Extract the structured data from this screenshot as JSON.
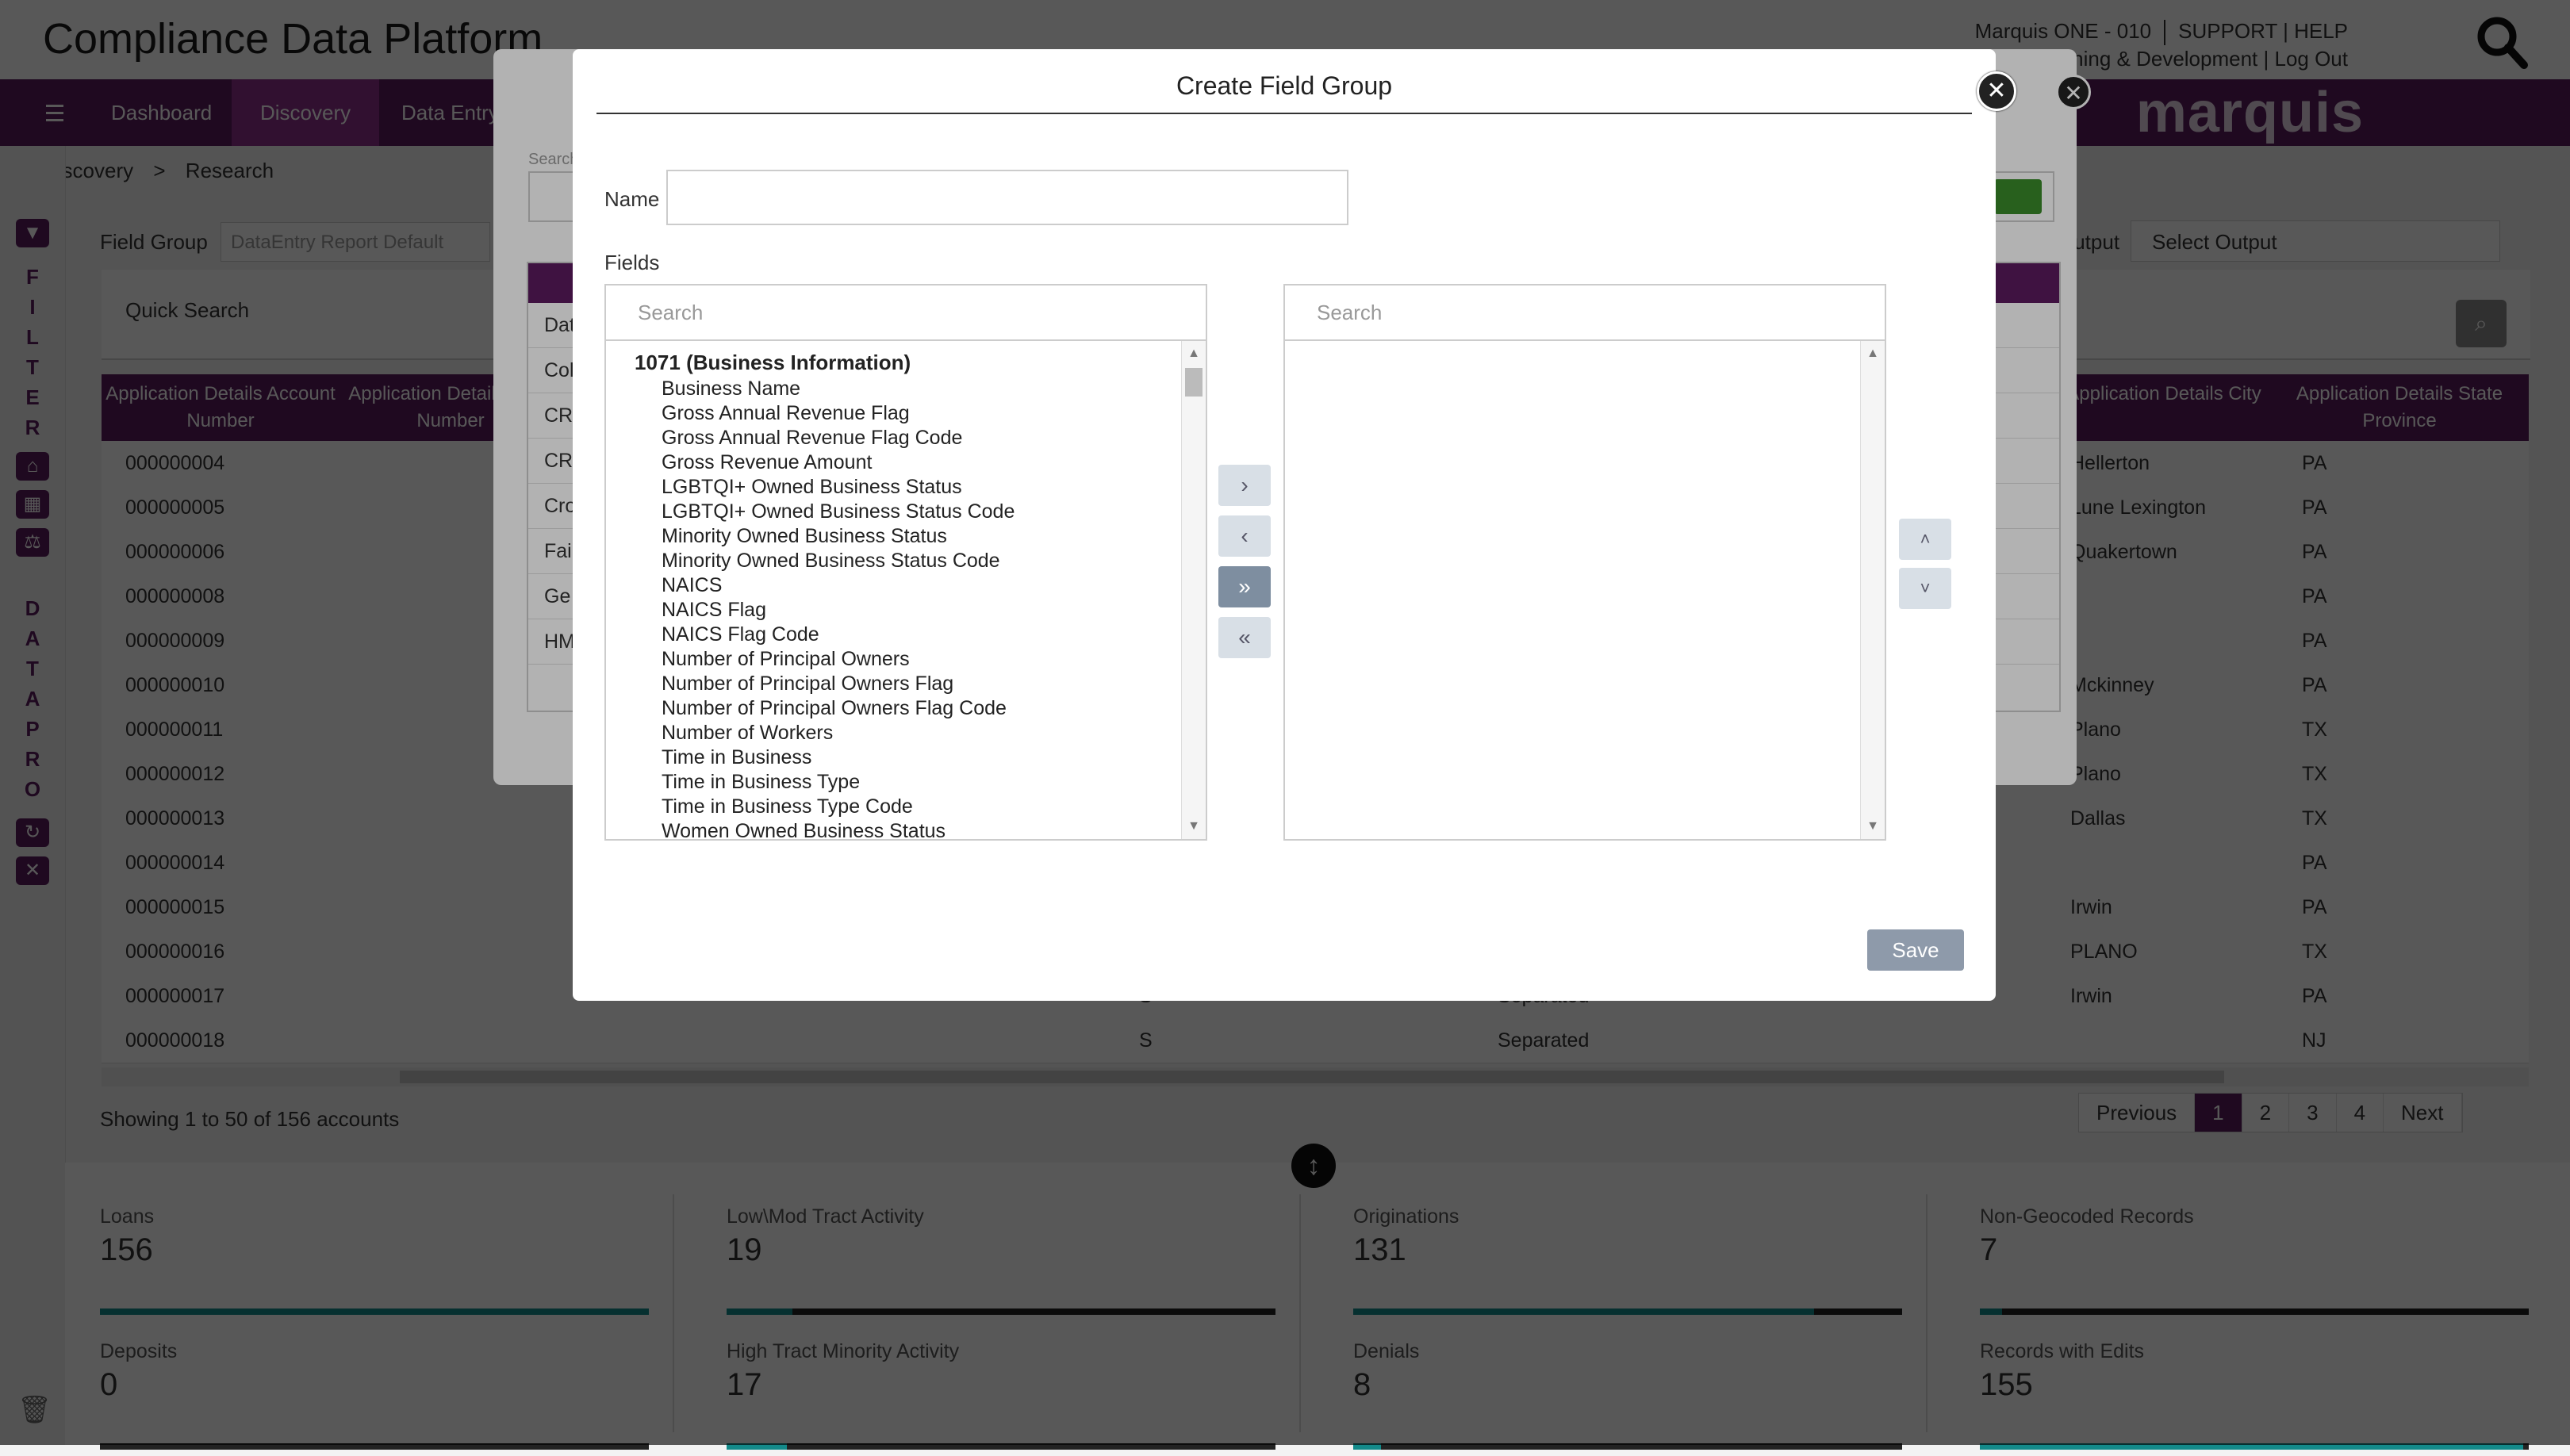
{
  "app": {
    "title": "Compliance Data Platform",
    "account_line1": "Marquis ONE - 010",
    "support": "SUPPORT | HELP",
    "account_line2": "Marquis Learning & Development | Log Out",
    "brand": "marquis"
  },
  "nav": {
    "items": [
      "Dashboard",
      "Discovery",
      "Data Entry"
    ],
    "active": "Discovery"
  },
  "breadcrumb": {
    "root": "Discovery",
    "sep": ">",
    "current": "Research"
  },
  "rail": {
    "filter_letters": [
      "F",
      "I",
      "L",
      "T",
      "E",
      "R"
    ],
    "datapro_letters": [
      "D",
      "A",
      "T",
      "A",
      "P",
      "R",
      "O"
    ]
  },
  "main": {
    "field_group_label": "Field Group",
    "field_group_value": "DataEntry Report Default",
    "output_label": "Output",
    "output_value": "Select Output",
    "quick_search": "Quick Search",
    "columns": [
      "Application Details Account Number",
      "Application Details Loan Number",
      "Application Details City",
      "Application Details State Province"
    ],
    "rows": [
      {
        "acct": "000000004",
        "mid1": "",
        "mid2": "",
        "city": "Hellerton",
        "state": "PA"
      },
      {
        "acct": "000000005",
        "mid1": "",
        "mid2": "",
        "city": "Lune Lexington",
        "state": "PA"
      },
      {
        "acct": "000000006",
        "mid1": "",
        "mid2": "",
        "city": "Quakertown",
        "state": "PA"
      },
      {
        "acct": "000000008",
        "mid1": "",
        "mid2": "",
        "city": "",
        "state": "PA"
      },
      {
        "acct": "000000009",
        "mid1": "",
        "mid2": "",
        "city": "",
        "state": "PA"
      },
      {
        "acct": "000000010",
        "mid1": "",
        "mid2": "",
        "city": "Mckinney",
        "state": "PA"
      },
      {
        "acct": "000000011",
        "mid1": "",
        "mid2": "",
        "city": "Plano",
        "state": "TX"
      },
      {
        "acct": "000000012",
        "mid1": "",
        "mid2": "",
        "city": "Plano",
        "state": "TX"
      },
      {
        "acct": "000000013",
        "mid1": "",
        "mid2": "",
        "city": "Dallas",
        "state": "TX"
      },
      {
        "acct": "000000014",
        "mid1": "",
        "mid2": "",
        "city": "",
        "state": "PA"
      },
      {
        "acct": "000000015",
        "mid1": "",
        "mid2": "",
        "city": "Irwin",
        "state": "PA"
      },
      {
        "acct": "000000016",
        "mid1": "",
        "mid2": "",
        "city": "PLANO",
        "state": "TX"
      },
      {
        "acct": "000000017",
        "mid1": "S",
        "mid2": "Separated",
        "city": "Irwin",
        "state": "PA"
      },
      {
        "acct": "000000018",
        "mid1": "S",
        "mid2": "Separated",
        "city": "",
        "state": "NJ"
      }
    ],
    "showing": "Showing 1 to 50 of 156 accounts",
    "pager": [
      "Previous",
      "1",
      "2",
      "3",
      "4",
      "Next"
    ]
  },
  "stats": [
    {
      "label": "Loans",
      "value": "156",
      "fill": 1.0
    },
    {
      "label": "Low\\Mod Tract Activity",
      "value": "19",
      "fill": 0.12
    },
    {
      "label": "Originations",
      "value": "131",
      "fill": 0.84
    },
    {
      "label": "Non-Geocoded Records",
      "value": "7",
      "fill": 0.04
    },
    {
      "label": "Deposits",
      "value": "0",
      "fill": 0.0
    },
    {
      "label": "High Tract Minority Activity",
      "value": "17",
      "fill": 0.11
    },
    {
      "label": "Denials",
      "value": "8",
      "fill": 0.05
    },
    {
      "label": "Records with Edits",
      "value": "155",
      "fill": 0.99
    }
  ],
  "under_modal": {
    "search_label": "Search",
    "rows": [
      "Dat",
      "Col",
      "CR",
      "CR",
      "Cro",
      "Fai",
      "Ge",
      "HM"
    ]
  },
  "modal": {
    "title": "Create Field Group",
    "name_label": "Name",
    "name_value": "",
    "fields_label": "Fields",
    "left_search_placeholder": "Search",
    "right_search_placeholder": "Search",
    "group_name": "1071 (Business Information)",
    "fields": [
      "Business Name",
      "Gross Annual Revenue Flag",
      "Gross Annual Revenue Flag Code",
      "Gross Revenue Amount",
      "LGBTQI+ Owned Business Status",
      "LGBTQI+ Owned Business Status Code",
      "Minority Owned Business Status",
      "Minority Owned Business Status Code",
      "NAICS",
      "NAICS Flag",
      "NAICS Flag Code",
      "Number of Principal Owners",
      "Number of Principal Owners Flag",
      "Number of Principal Owners Flag Code",
      "Number of Workers",
      "Time in Business",
      "Time in Business Type",
      "Time in Business Type Code",
      "Women Owned Business Status"
    ],
    "move_buttons": [
      "›",
      "‹",
      "»",
      "«"
    ],
    "order_buttons": [
      "˄",
      "˅"
    ],
    "save_label": "Save"
  }
}
